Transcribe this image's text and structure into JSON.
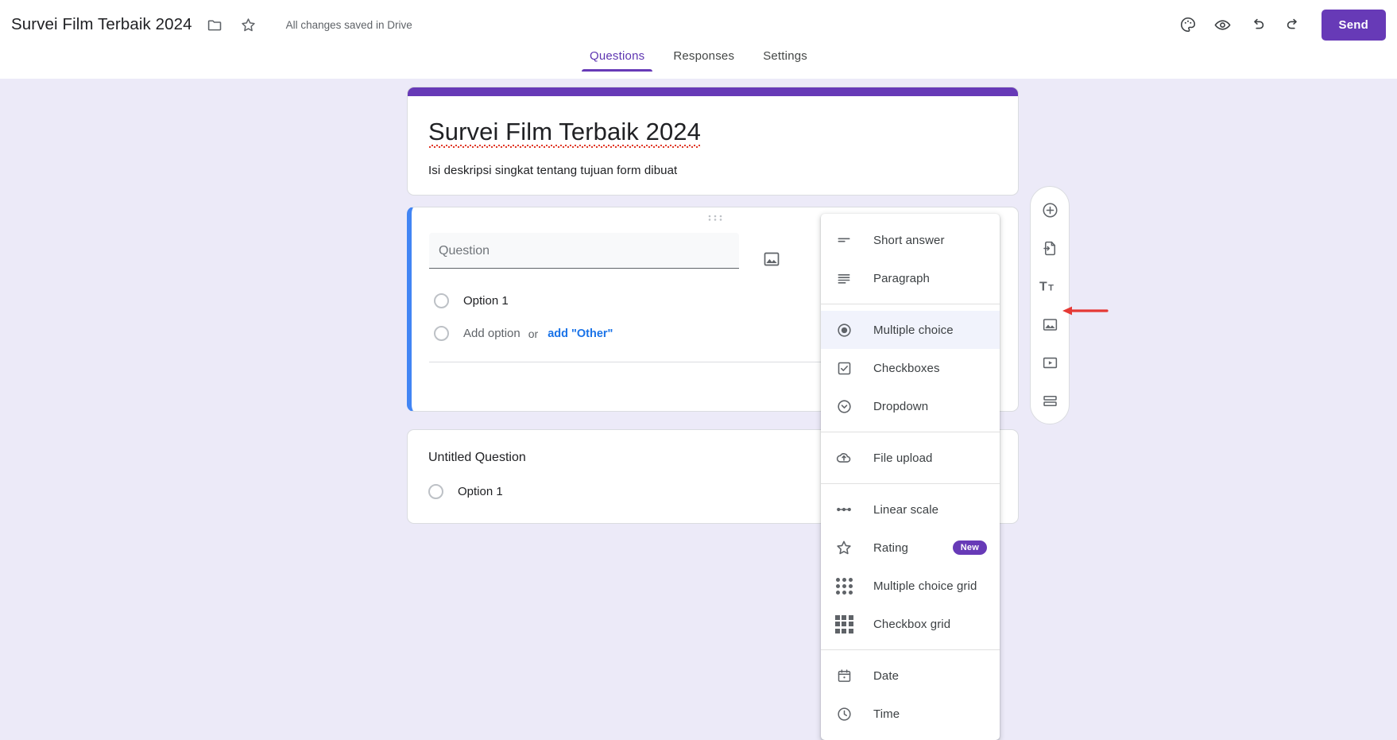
{
  "topbar": {
    "form_title": "Survei Film Terbaik 2024",
    "folder_icon": "folder-icon",
    "star_icon": "star-icon",
    "saved_status": "All changes saved in Drive",
    "theme_icon": "palette-icon",
    "preview_icon": "eye-icon",
    "undo_icon": "undo-icon",
    "redo_icon": "redo-icon",
    "send_label": "Send"
  },
  "tabs": [
    {
      "label": "Questions",
      "active": true
    },
    {
      "label": "Responses",
      "active": false
    },
    {
      "label": "Settings",
      "active": false
    }
  ],
  "form": {
    "title": "Survei Film Terbaik 2024",
    "description": "Isi deskripsi singkat tentang tujuan form dibuat",
    "header_color": "#673AB7"
  },
  "question_active": {
    "question_placeholder": "Question",
    "image_button_icon": "image-icon",
    "drag_handle_icon": "drag-handle-icon",
    "options": [
      {
        "label": "Option 1"
      }
    ],
    "add_option_label": "Add option",
    "or_label": "or",
    "add_other_label": "add \"Other\"",
    "duplicate_icon": "duplicate-icon"
  },
  "question_second": {
    "title": "Untitled Question",
    "options": [
      {
        "label": "Option 1"
      }
    ]
  },
  "float_toolbar": [
    {
      "name": "add-question-button",
      "icon": "plus-circle-icon"
    },
    {
      "name": "import-questions-button",
      "icon": "import-file-icon"
    },
    {
      "name": "add-title-description-button",
      "icon": "title-text-icon"
    },
    {
      "name": "add-image-button",
      "icon": "image-icon"
    },
    {
      "name": "add-video-button",
      "icon": "video-icon"
    },
    {
      "name": "add-section-button",
      "icon": "section-icon"
    }
  ],
  "menu": {
    "groups": [
      {
        "items": [
          {
            "label": "Short answer",
            "icon": "short-answer-icon",
            "selected": false
          },
          {
            "label": "Paragraph",
            "icon": "paragraph-icon",
            "selected": false
          }
        ]
      },
      {
        "items": [
          {
            "label": "Multiple choice",
            "icon": "radio-icon",
            "selected": true
          },
          {
            "label": "Checkboxes",
            "icon": "checkbox-icon",
            "selected": false
          },
          {
            "label": "Dropdown",
            "icon": "dropdown-icon",
            "selected": false
          }
        ]
      },
      {
        "items": [
          {
            "label": "File upload",
            "icon": "cloud-upload-icon",
            "selected": false
          }
        ]
      },
      {
        "items": [
          {
            "label": "Linear scale",
            "icon": "linear-scale-icon",
            "selected": false
          },
          {
            "label": "Rating",
            "icon": "star-outline-icon",
            "selected": false,
            "badge": "New"
          },
          {
            "label": "Multiple choice grid",
            "icon": "dot-grid-icon",
            "selected": false
          },
          {
            "label": "Checkbox grid",
            "icon": "square-grid-icon",
            "selected": false
          }
        ]
      },
      {
        "items": [
          {
            "label": "Date",
            "icon": "calendar-icon",
            "selected": false
          },
          {
            "label": "Time",
            "icon": "clock-icon",
            "selected": false
          }
        ]
      }
    ]
  },
  "annotation": {
    "arrow_color": "#E53935"
  }
}
